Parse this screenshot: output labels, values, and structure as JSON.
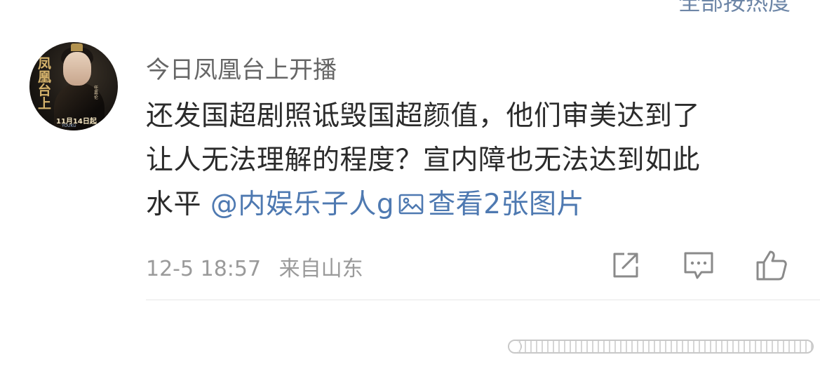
{
  "top": {
    "partial_text": "全部按热度"
  },
  "comment": {
    "avatar": {
      "title": "凤凰台上",
      "date": "11月14日起",
      "brand": "YOUKU",
      "side": "任嘉伦"
    },
    "username": "今日凤凰台上开播",
    "lines": [
      "还发国超剧照诋毁国超颜值，他们审美达到了",
      "让人无法理解的程度？宣内障也无法达到如此",
      "水平"
    ],
    "mention": "@内娱乐子人g",
    "view_images": "查看2张图片",
    "timestamp": "12-5 18:57",
    "location": "来自山东"
  },
  "actions": {
    "share_icon": "share-icon",
    "comment_icon": "comment-icon",
    "like_icon": "thumbs-up-icon"
  },
  "colors": {
    "text": "#2b2b2b",
    "username": "#666666",
    "link": "#4e79b1",
    "meta": "#9a9a9a",
    "icon": "#8a8a8a"
  }
}
